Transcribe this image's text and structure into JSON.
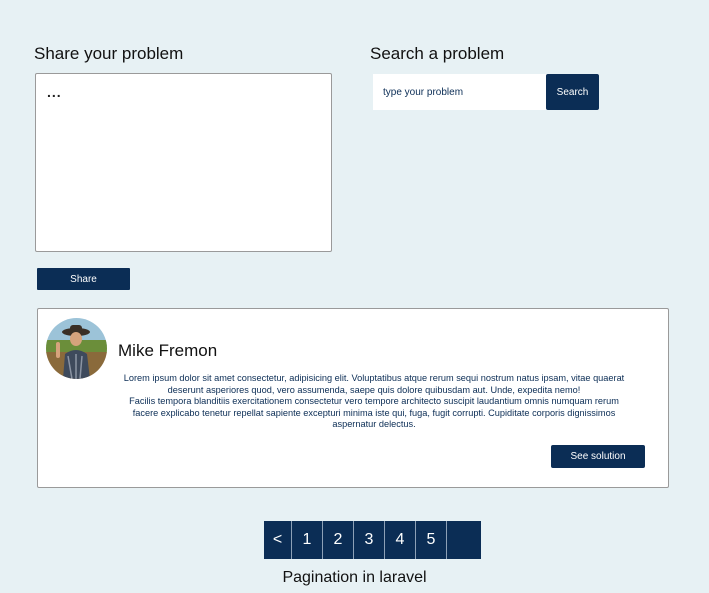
{
  "share": {
    "title": "Share your problem",
    "textarea_placeholder": "...",
    "button_label": "Share"
  },
  "search": {
    "title": "Search a problem",
    "input_placeholder": "type your problem",
    "button_label": "Search"
  },
  "post": {
    "author": "Mike Fremon",
    "avatar_icon": "farmer-avatar",
    "body_lines": [
      "Lorem ipsum dolor sit amet consectetur, adipisicing elit. Voluptatibus atque rerum sequi nostrum natus ipsam, vitae quaerat",
      "deserunt asperiores quod, vero assumenda, saepe quis dolore quibusdam aut. Unde, expedita nemo!",
      "Facilis tempora blanditiis exercitationem consectetur vero tempore architecto suscipit laudantium omnis numquam rerum",
      "facere explicabo tenetur repellat sapiente excepturi minima iste qui, fuga, fugit corrupti. Cupiditate corporis dignissimos",
      "aspernatur delectus."
    ],
    "solution_button_label": "See  solution"
  },
  "pagination": {
    "prev_label": "<",
    "pages": [
      "1",
      "2",
      "3",
      "4",
      "5"
    ],
    "next_label": "",
    "caption": "Pagination in laravel"
  },
  "colors": {
    "background": "#e7f1f4",
    "primary": "#0b2d55"
  }
}
